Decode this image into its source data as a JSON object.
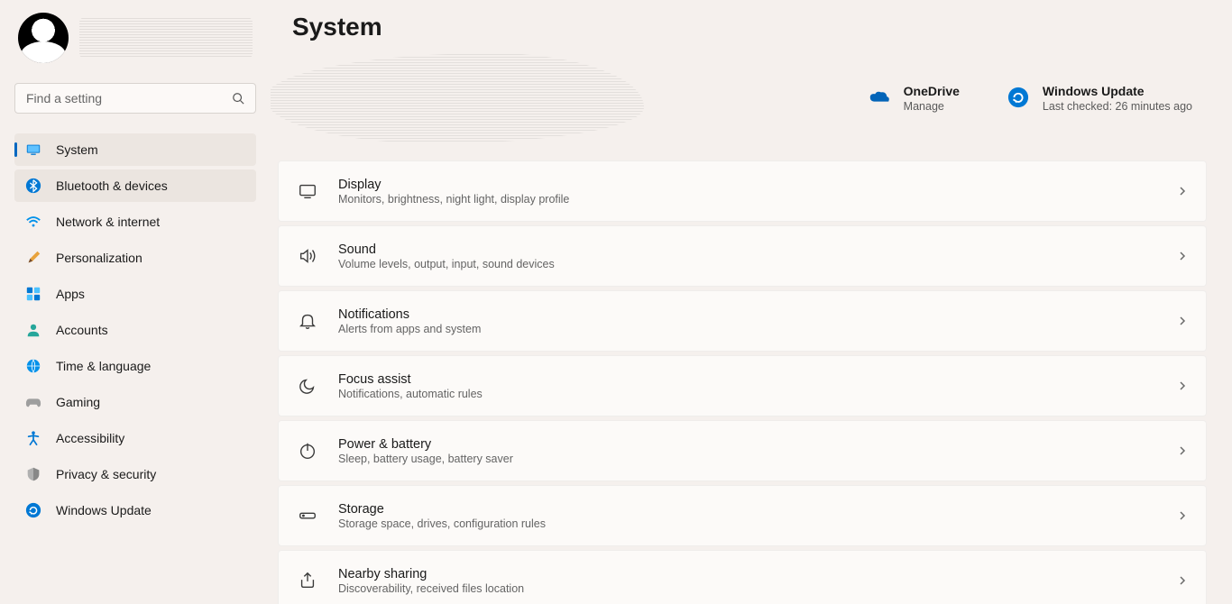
{
  "search": {
    "placeholder": "Find a setting"
  },
  "nav": [
    {
      "id": "system",
      "label": "System"
    },
    {
      "id": "bluetooth",
      "label": "Bluetooth & devices"
    },
    {
      "id": "network",
      "label": "Network & internet"
    },
    {
      "id": "personalization",
      "label": "Personalization"
    },
    {
      "id": "apps",
      "label": "Apps"
    },
    {
      "id": "accounts",
      "label": "Accounts"
    },
    {
      "id": "time",
      "label": "Time & language"
    },
    {
      "id": "gaming",
      "label": "Gaming"
    },
    {
      "id": "accessibility",
      "label": "Accessibility"
    },
    {
      "id": "privacy",
      "label": "Privacy & security"
    },
    {
      "id": "update",
      "label": "Windows Update"
    }
  ],
  "page": {
    "title": "System"
  },
  "widgets": {
    "onedrive": {
      "title": "OneDrive",
      "subtitle": "Manage"
    },
    "update": {
      "title": "Windows Update",
      "subtitle": "Last checked: 26 minutes ago"
    }
  },
  "settings": [
    {
      "id": "display",
      "title": "Display",
      "desc": "Monitors, brightness, night light, display profile"
    },
    {
      "id": "sound",
      "title": "Sound",
      "desc": "Volume levels, output, input, sound devices"
    },
    {
      "id": "notifications",
      "title": "Notifications",
      "desc": "Alerts from apps and system"
    },
    {
      "id": "focus",
      "title": "Focus assist",
      "desc": "Notifications, automatic rules"
    },
    {
      "id": "power",
      "title": "Power & battery",
      "desc": "Sleep, battery usage, battery saver"
    },
    {
      "id": "storage",
      "title": "Storage",
      "desc": "Storage space, drives, configuration rules"
    },
    {
      "id": "nearby",
      "title": "Nearby sharing",
      "desc": "Discoverability, received files location"
    }
  ]
}
